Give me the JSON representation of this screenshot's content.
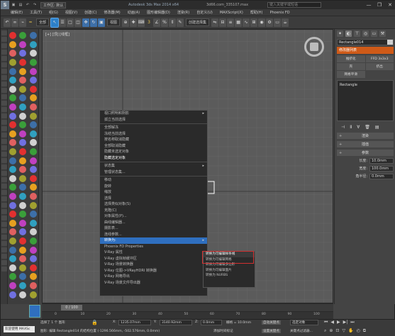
{
  "titlebar": {
    "workspace_label": "工作区: 默认",
    "app_title": "Autodesk 3ds Max  2014 x64",
    "file_title": "3d66.com_335107.max",
    "search_placeholder": "键入关键字或短语",
    "minimize": "—",
    "restore": "❐",
    "close": "✕"
  },
  "menubar": {
    "items": [
      "编辑(E)",
      "工具(T)",
      "组(G)",
      "视图(V)",
      "创建(C)",
      "修改器(M)",
      "动画(A)",
      "图形编辑器(D)",
      "渲染(R)",
      "自定义(U)",
      "MAXScript(X)",
      "帮助(H)",
      "Phoenix FD"
    ]
  },
  "toolbar": {
    "filter_dropdown": "全部",
    "view_dropdown": "视图",
    "selection_set": "创建选择集"
  },
  "viewport": {
    "label": "[+] [顶] [线框]"
  },
  "quad_menu": {
    "sections": [
      {
        "items": [
          {
            "label": "视口照明和阴影",
            "arrow": "▸"
          },
          {
            "label": "孤立当前选择"
          }
        ]
      },
      {
        "items": [
          {
            "label": "全部解冻"
          },
          {
            "label": "冻结当前选择"
          },
          {
            "label": "按名称取消隐藏"
          },
          {
            "label": "全部取消隐藏"
          },
          {
            "label": "隐藏未选定对象"
          },
          {
            "label": "隐藏选定对象",
            "bright": true
          }
        ]
      },
      {
        "items": [
          {
            "label": "状态集",
            "arrow": "▸"
          },
          {
            "label": "管理状态集..."
          }
        ]
      },
      {
        "items": [
          {
            "label": "移动"
          },
          {
            "label": "旋转"
          },
          {
            "label": "缩放"
          },
          {
            "label": "选择"
          },
          {
            "label": "选择类似对象(S)"
          },
          {
            "label": "克隆(C)"
          },
          {
            "label": "对象属性(P)..."
          },
          {
            "label": "曲线编辑器..."
          },
          {
            "label": "摄影表..."
          },
          {
            "label": "连线参数..."
          },
          {
            "label": "转换为:",
            "arrow": "▸",
            "highlight": true
          },
          {
            "label": "Phoenix FD Properties"
          },
          {
            "label": "V-Ray 属性"
          },
          {
            "label": "V-Ray 虚拟帧缓冲区"
          },
          {
            "label": "V-Ray 场景转换器"
          },
          {
            "label": "V-Ray 位图->VRayHDRI 转换器"
          },
          {
            "label": "V-Ray 网格导出"
          },
          {
            "label": "V-Ray 场景文件导出器"
          }
        ]
      }
    ]
  },
  "submenu": {
    "items": [
      {
        "label": "转换为可编辑样条线",
        "bright": true
      },
      {
        "label": "转换为可编辑网格"
      },
      {
        "label": "转换为可编辑多边形"
      },
      {
        "label": "转换为可编辑面片"
      },
      {
        "label": "转换为 NURBS"
      }
    ]
  },
  "command_panel": {
    "object_name": "Rectangle014",
    "modifier_list": "修改器列表",
    "buttons": [
      "推挤化",
      "FFD 3x3x3",
      "壳",
      "挤出",
      "网格平滑"
    ],
    "stack_item": "Rectangle",
    "rollouts": {
      "render": "渲染",
      "interp": "插值",
      "params": "参数"
    },
    "params": [
      {
        "label": "长度:",
        "value": "10.0mm"
      },
      {
        "label": "宽度:",
        "value": "100.0mm"
      },
      {
        "label": "角半径:",
        "value": "0.0mm"
      }
    ]
  },
  "timeline": {
    "slider": "0 / 100",
    "ticks": [
      "0",
      "10",
      "20",
      "30",
      "40",
      "50",
      "60",
      "70",
      "80",
      "90",
      "100"
    ]
  },
  "statusbar": {
    "max_label": "欢迎使用 MAXSc",
    "selected": "选择了 1 个 图形",
    "prompt": "图形: 编辑 Rectangle014 的结构位置 (-1296.566mm, -502.576mm, 0.0mm)",
    "x_label": "X:",
    "x_value": "1235.07mm",
    "y_label": "Y:",
    "y_value": "3140.92mm",
    "z_label": "Z:",
    "z_value": "0.0mm",
    "grid": "栅格 = 10.0mm",
    "autokey": "自动关键点",
    "selected_obj": "选定对象",
    "set_key": "设置关键点",
    "key_filter": "关键点过滤器...",
    "add_time_tag": "添加时间标记"
  }
}
